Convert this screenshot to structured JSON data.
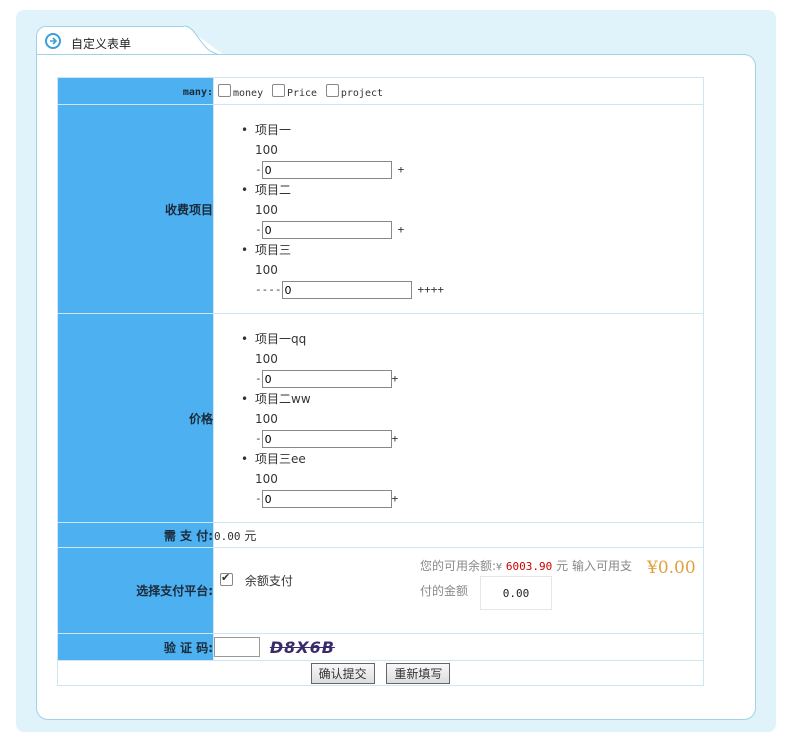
{
  "form_title": "自定义表单",
  "rows": {
    "many_label": "many:",
    "many_options": [
      "money",
      "Price",
      "project"
    ],
    "fee_label": "收费项目",
    "fee_items": [
      {
        "name": "项目一",
        "price": "100",
        "prefix": "-",
        "qty": "0",
        "suffix": "+"
      },
      {
        "name": "项目二",
        "price": "100",
        "prefix": "-",
        "qty": "0",
        "suffix": "+"
      },
      {
        "name": "项目三",
        "price": "100",
        "prefix": "----",
        "qty": "0",
        "suffix": "++++"
      }
    ],
    "price_label": "价格",
    "price_items": [
      {
        "name": "项目一qq",
        "price": "100",
        "prefix": "-",
        "qty": "0",
        "suffix": "+"
      },
      {
        "name": "项目二ww",
        "price": "100",
        "prefix": "-",
        "qty": "0",
        "suffix": "+"
      },
      {
        "name": "项目三ee",
        "price": "100",
        "prefix": "-",
        "qty": "0",
        "suffix": "+"
      }
    ],
    "pay_label": "需 支 付:",
    "pay_amount": "0.00",
    "pay_unit": "元",
    "platform_label": "选择支付平台:",
    "platform_option": "余额支付",
    "balance_prefix": "您的可用余额:",
    "balance_currency": "¥",
    "balance_value": "6003.90",
    "balance_unit": "元",
    "input_hint_1": "输入可用支",
    "input_hint_2": "付的金额",
    "input_amount": "0.00",
    "big_amount": "¥0.00",
    "captcha_label": "验 证 码:",
    "captcha_text": "D8X6B"
  },
  "buttons": {
    "submit": "确认提交",
    "reset": "重新填写"
  },
  "colors": {
    "label_bg": "#4db0f0",
    "outer_bg": "#e0f3fb",
    "balance_red": "#cc0000",
    "big_amount": "#e0a040"
  }
}
